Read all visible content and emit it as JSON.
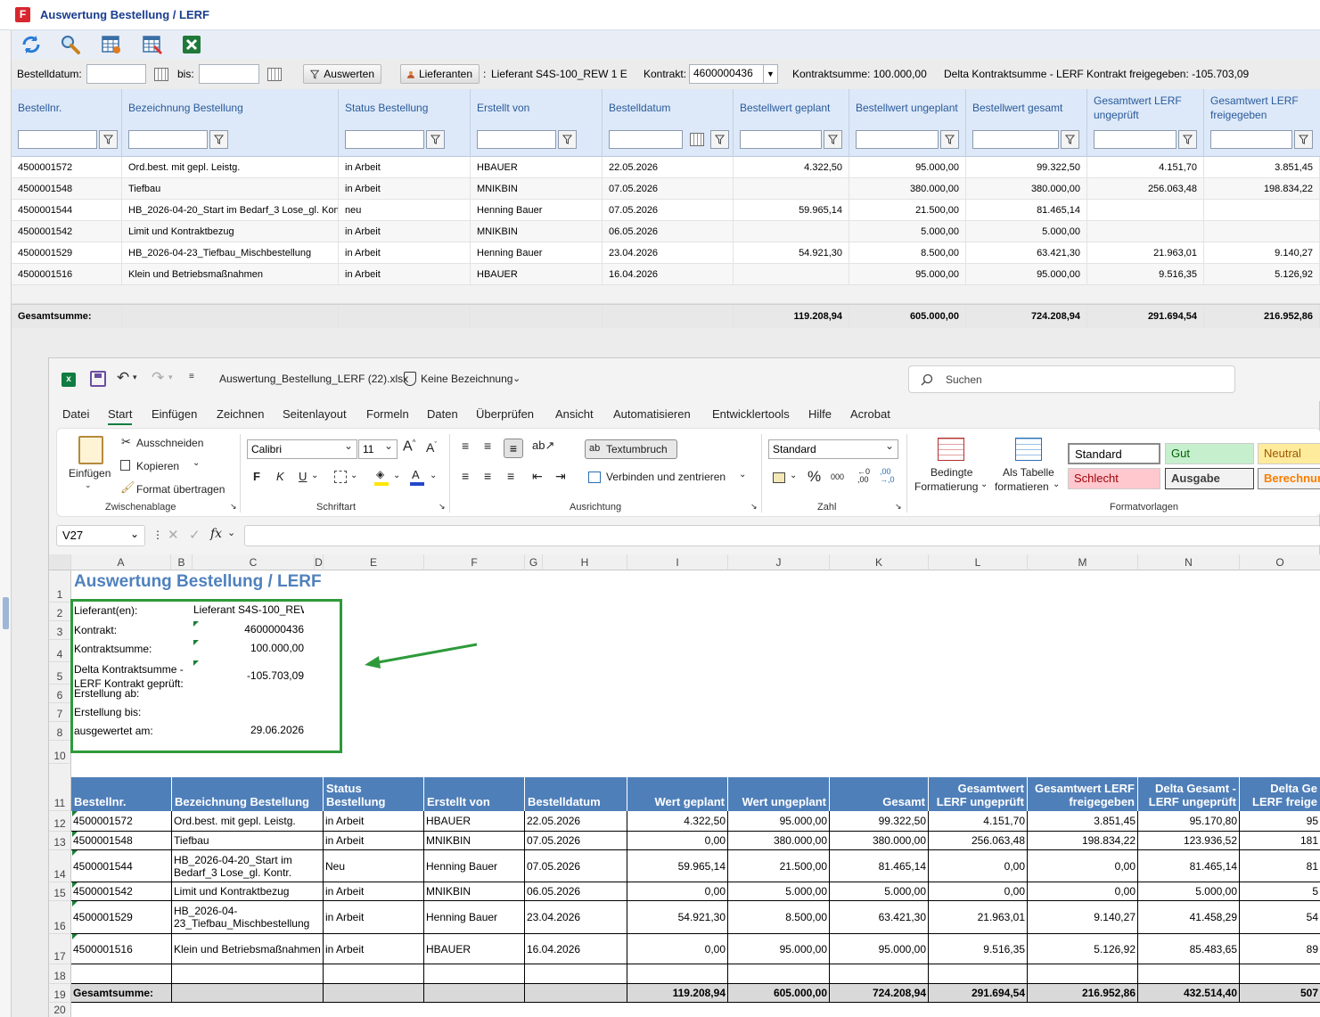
{
  "app": {
    "title": "Auswertung Bestellung / LERF"
  },
  "filterbar": {
    "bestelldatum_label": "Bestelldatum:",
    "bis_label": "bis:",
    "auswerten_label": "Auswerten",
    "lieferanten_label": "Lieferanten",
    "lieferant_sep": ":",
    "lieferant_value": "Lieferant S4S-100_REW 1 E",
    "kontrakt_label": "Kontrakt:",
    "kontrakt_value": "4600000436",
    "kontraktsumme": "Kontraktsumme: 100.000,00",
    "delta": "Delta Kontraktsumme - LERF Kontrakt freigegeben: -105.703,09"
  },
  "grid": {
    "columns": [
      "Bestellnr.",
      "Bezeichnung Bestellung",
      "Status Bestellung",
      "Erstellt von",
      "Bestelldatum",
      "Bestellwert geplant",
      "Bestellwert ungeplant",
      "Bestellwert gesamt",
      "Gesamtwert LERF ungeprüft",
      "Gesamtwert LERF freigegeben"
    ],
    "rows": [
      [
        "4500001572",
        "Ord.best. mit gepl. Leistg.",
        "in Arbeit",
        "HBAUER",
        "22.05.2026",
        "4.322,50",
        "95.000,00",
        "99.322,50",
        "4.151,70",
        "3.851,45"
      ],
      [
        "4500001548",
        "Tiefbau",
        "in Arbeit",
        "MNIKBIN",
        "07.05.2026",
        "",
        "380.000,00",
        "380.000,00",
        "256.063,48",
        "198.834,22"
      ],
      [
        "4500001544",
        "HB_2026-04-20_Start im Bedarf_3 Lose_gl. Kontr.",
        "neu",
        "Henning Bauer",
        "07.05.2026",
        "59.965,14",
        "21.500,00",
        "81.465,14",
        "",
        ""
      ],
      [
        "4500001542",
        "Limit und Kontraktbezug",
        "in Arbeit",
        "MNIKBIN",
        "06.05.2026",
        "",
        "5.000,00",
        "5.000,00",
        "",
        ""
      ],
      [
        "4500001529",
        "HB_2026-04-23_Tiefbau_Mischbestellung",
        "in Arbeit",
        "Henning Bauer",
        "23.04.2026",
        "54.921,30",
        "8.500,00",
        "63.421,30",
        "21.963,01",
        "9.140,27"
      ],
      [
        "4500001516",
        "Klein und Betriebsmaßnahmen",
        "in Arbeit",
        "HBAUER",
        "16.04.2026",
        "",
        "95.000,00",
        "95.000,00",
        "9.516,35",
        "5.126,92"
      ]
    ],
    "sum_label": "Gesamtsumme:",
    "sums": [
      "119.208,94",
      "605.000,00",
      "724.208,94",
      "291.694,54",
      "216.952,86"
    ]
  },
  "excel": {
    "filename": "Auswertung_Bestellung_LERF (22).xlsx",
    "label": "Keine Bezeichnung",
    "search_placeholder": "Suchen",
    "menu": [
      "Datei",
      "Start",
      "Einfügen",
      "Zeichnen",
      "Seitenlayout",
      "Formeln",
      "Daten",
      "Überprüfen",
      "Ansicht",
      "Automatisieren",
      "Entwicklertools",
      "Hilfe",
      "Acrobat"
    ],
    "ribbon": {
      "einfuegen": "Einfügen",
      "ausschneiden": "Ausschneiden",
      "kopieren": "Kopieren",
      "format": "Format übertragen",
      "zwischenablage": "Zwischenablage",
      "font": "Calibri",
      "size": "11",
      "bold": "F",
      "italic": "K",
      "underline": "U",
      "schriftart": "Schriftart",
      "textumbruch": "Textumbruch",
      "verbinden": "Verbinden und zentrieren",
      "ausrichtung": "Ausrichtung",
      "numfmt": "Standard",
      "percent": "%",
      "thousand": "000",
      "zahl": "Zahl",
      "bedingte1": "Bedingte",
      "bedingte2": "Formatierung",
      "tabelle1": "Als Tabelle",
      "tabelle2": "formatieren",
      "styles": [
        "Standard",
        "Gut",
        "Neutral",
        "Schlecht",
        "Ausgabe",
        "Berechnun"
      ],
      "formatvorlagen": "Formatvorlagen"
    },
    "namebox": "V27",
    "fx": "fx",
    "columns": [
      "A",
      "B",
      "C",
      "D",
      "E",
      "F",
      "G",
      "H",
      "I",
      "J",
      "K",
      "L",
      "M",
      "N",
      "O"
    ],
    "rows": [
      "1",
      "2",
      "3",
      "4",
      "5",
      "6",
      "7",
      "8",
      "10",
      "11",
      "12",
      "13",
      "14",
      "15",
      "16",
      "17",
      "18",
      "19",
      "20"
    ],
    "sheet_title": "Auswertung Bestellung / LERF",
    "info": [
      {
        "label": "Lieferant(en):",
        "value": "Lieferant S4S-100_REW 1 E"
      },
      {
        "label": "Kontrakt:",
        "value": "4600000436"
      },
      {
        "label": "Kontraktsumme:",
        "value": "100.000,00"
      },
      {
        "label": "Delta Kontraktsumme - LERF Kontrakt geprüft:",
        "value": "-105.703,09"
      },
      {
        "label": "Erstellung ab:",
        "value": ""
      },
      {
        "label": "Erstellung bis:",
        "value": ""
      },
      {
        "label": "ausgewertet am:",
        "value": "29.06.2026"
      }
    ],
    "table_headers": [
      "Bestellnr.",
      "Bezeichnung Bestellung",
      "Status Bestellung",
      "Erstellt von",
      "Bestelldatum",
      "Wert geplant",
      "Wert ungeplant",
      "Gesamt",
      "Gesamtwert LERF ungeprüft",
      "Gesamtwert LERF freigegeben",
      "Delta Gesamt - LERF ungeprüft",
      "Delta Ge LERF freige"
    ],
    "table_rows": [
      [
        "4500001572",
        "Ord.best. mit gepl. Leistg.",
        "in Arbeit",
        "HBAUER",
        "22.05.2026",
        "4.322,50",
        "95.000,00",
        "99.322,50",
        "4.151,70",
        "3.851,45",
        "95.170,80",
        "95"
      ],
      [
        "4500001548",
        "Tiefbau",
        "in Arbeit",
        "MNIKBIN",
        "07.05.2026",
        "0,00",
        "380.000,00",
        "380.000,00",
        "256.063,48",
        "198.834,22",
        "123.936,52",
        "181"
      ],
      [
        "4500001544",
        "HB_2026-04-20_Start im Bedarf_3 Lose_gl. Kontr.",
        "Neu",
        "Henning Bauer",
        "07.05.2026",
        "59.965,14",
        "21.500,00",
        "81.465,14",
        "0,00",
        "0,00",
        "81.465,14",
        "81"
      ],
      [
        "4500001542",
        "Limit und Kontraktbezug",
        "in Arbeit",
        "MNIKBIN",
        "06.05.2026",
        "0,00",
        "5.000,00",
        "5.000,00",
        "0,00",
        "0,00",
        "5.000,00",
        "5"
      ],
      [
        "4500001529",
        "HB_2026-04-23_Tiefbau_Mischbestellung",
        "in Arbeit",
        "Henning Bauer",
        "23.04.2026",
        "54.921,30",
        "8.500,00",
        "63.421,30",
        "21.963,01",
        "9.140,27",
        "41.458,29",
        "54"
      ],
      [
        "4500001516",
        "Klein und Betriebsmaßnahmen",
        "in Arbeit",
        "HBAUER",
        "16.04.2026",
        "0,00",
        "95.000,00",
        "95.000,00",
        "9.516,35",
        "5.126,92",
        "85.483,65",
        "89"
      ]
    ],
    "sum_label": "Gesamtsumme:",
    "sums": [
      "119.208,94",
      "605.000,00",
      "724.208,94",
      "291.694,54",
      "216.952,86",
      "432.514,40",
      "507"
    ]
  },
  "colors": {
    "excel_header": "#4f7fb9",
    "grid_header": "#dde9f8",
    "highlight_box": "#2e9a3a",
    "app_title": "#1a3d8f"
  }
}
